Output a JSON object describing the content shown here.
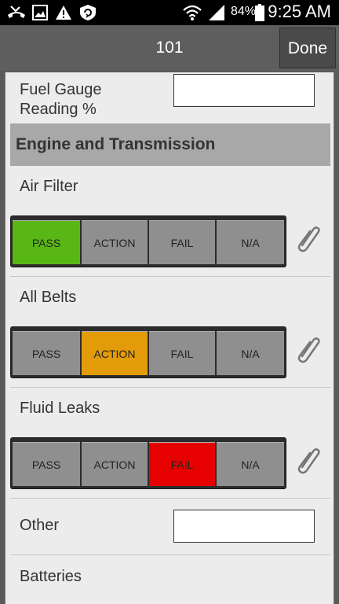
{
  "status_bar": {
    "battery_pct": "84%",
    "time": "9:25 AM",
    "icons": [
      "missed-call-icon",
      "image-icon",
      "warning-icon",
      "shield-sync-icon",
      "wifi-icon",
      "signal-icon",
      "battery-icon"
    ]
  },
  "header": {
    "title": "101",
    "done_label": "Done"
  },
  "form": {
    "fuel_label": "Fuel Gauge Reading %",
    "fuel_value": "",
    "section_title": "Engine and Transmission",
    "items": [
      {
        "label": "Air Filter",
        "selected": "PASS"
      },
      {
        "label": "All Belts",
        "selected": "ACTION"
      },
      {
        "label": "Fluid Leaks",
        "selected": "FAIL"
      }
    ],
    "options": [
      "PASS",
      "ACTION",
      "FAIL",
      "N/A"
    ],
    "other_label": "Other",
    "other_value": "",
    "batteries_label": "Batteries"
  },
  "colors": {
    "pass": "#58b714",
    "action": "#e39b0a",
    "fail": "#e60000",
    "neutral": "#8f8f8f"
  }
}
